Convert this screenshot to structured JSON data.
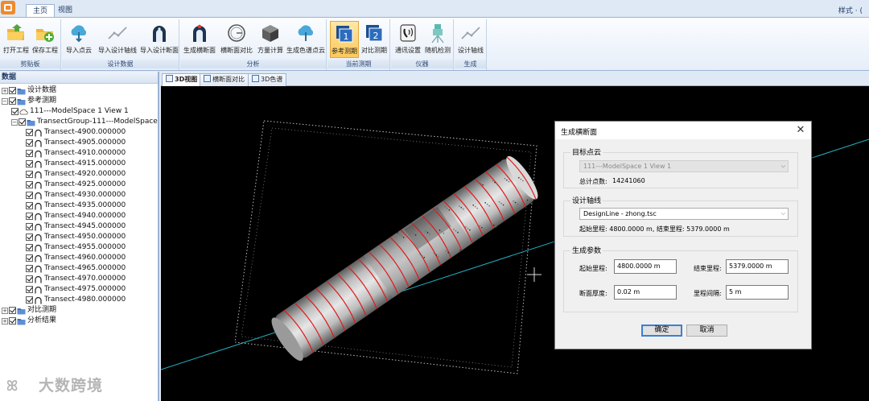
{
  "tabs": [
    {
      "label": "主页",
      "active": true
    },
    {
      "label": "视图",
      "active": false
    }
  ],
  "style_menu": "样式 · (",
  "ribbon": {
    "groups": [
      {
        "label": "剪贴板",
        "buttons": [
          {
            "label": "打开工程",
            "icon": "open-folder-icon"
          },
          {
            "label": "保存工程",
            "icon": "save-folder-icon"
          }
        ]
      },
      {
        "label": "设计数据",
        "buttons": [
          {
            "label": "导入点云",
            "icon": "cloud-import-icon"
          },
          {
            "label": "导入设计轴线",
            "icon": "axis-line-icon"
          },
          {
            "label": "导入设计断面",
            "icon": "tunnel-section-icon"
          }
        ]
      },
      {
        "label": "分析",
        "buttons": [
          {
            "label": "生成横断面",
            "icon": "tunnel-generate-icon"
          },
          {
            "label": "横断面对比",
            "icon": "circle-compare-icon"
          },
          {
            "label": "方量计算",
            "icon": "cube-volume-icon"
          },
          {
            "label": "生成色谱点云",
            "icon": "cloud-color-icon"
          }
        ]
      },
      {
        "label": "当前测期",
        "buttons": [
          {
            "label": "参考测期",
            "icon": "period-one-icon",
            "selected": true
          },
          {
            "label": "对比测期",
            "icon": "period-two-icon"
          }
        ]
      },
      {
        "label": "仪器",
        "buttons": [
          {
            "label": "通讯设置",
            "icon": "phone-settings-icon"
          },
          {
            "label": "随机检测",
            "icon": "instrument-icon"
          }
        ]
      },
      {
        "label": "生成",
        "buttons": [
          {
            "label": "设计轴线",
            "icon": "design-axis-icon"
          }
        ]
      }
    ]
  },
  "left_panel": {
    "header": "数据",
    "tree": [
      {
        "label": "设计数据",
        "level": 0,
        "expander": "+",
        "icon": "folder"
      },
      {
        "label": "参考测期",
        "level": 0,
        "expander": "−",
        "icon": "folder"
      },
      {
        "label": "111---ModelSpace 1 View 1",
        "level": 1,
        "expander": "",
        "icon": "cloud"
      },
      {
        "label": "TransectGroup-111---ModelSpace",
        "level": 1,
        "expander": "−",
        "icon": "folder"
      },
      {
        "label": "Transect-4900.000000",
        "level": 2,
        "expander": "",
        "icon": "section"
      },
      {
        "label": "Transect-4905.000000",
        "level": 2,
        "expander": "",
        "icon": "section"
      },
      {
        "label": "Transect-4910.000000",
        "level": 2,
        "expander": "",
        "icon": "section"
      },
      {
        "label": "Transect-4915.000000",
        "level": 2,
        "expander": "",
        "icon": "section"
      },
      {
        "label": "Transect-4920.000000",
        "level": 2,
        "expander": "",
        "icon": "section"
      },
      {
        "label": "Transect-4925.000000",
        "level": 2,
        "expander": "",
        "icon": "section"
      },
      {
        "label": "Transect-4930.000000",
        "level": 2,
        "expander": "",
        "icon": "section"
      },
      {
        "label": "Transect-4935.000000",
        "level": 2,
        "expander": "",
        "icon": "section"
      },
      {
        "label": "Transect-4940.000000",
        "level": 2,
        "expander": "",
        "icon": "section"
      },
      {
        "label": "Transect-4945.000000",
        "level": 2,
        "expander": "",
        "icon": "section"
      },
      {
        "label": "Transect-4950.000000",
        "level": 2,
        "expander": "",
        "icon": "section"
      },
      {
        "label": "Transect-4955.000000",
        "level": 2,
        "expander": "",
        "icon": "section"
      },
      {
        "label": "Transect-4960.000000",
        "level": 2,
        "expander": "",
        "icon": "section"
      },
      {
        "label": "Transect-4965.000000",
        "level": 2,
        "expander": "",
        "icon": "section"
      },
      {
        "label": "Transect-4970.000000",
        "level": 2,
        "expander": "",
        "icon": "section"
      },
      {
        "label": "Transect-4975.000000",
        "level": 2,
        "expander": "",
        "icon": "section"
      },
      {
        "label": "Transect-4980.000000",
        "level": 2,
        "expander": "",
        "icon": "section"
      },
      {
        "label": "对比测期",
        "level": 0,
        "expander": "+",
        "icon": "folder"
      },
      {
        "label": "分析结果",
        "level": 0,
        "expander": "+",
        "icon": "folder"
      }
    ]
  },
  "view_tabs": [
    {
      "label": "3D视图",
      "active": true
    },
    {
      "label": "横断面对比",
      "active": false
    },
    {
      "label": "3D色谱",
      "active": false
    }
  ],
  "dialog": {
    "title": "生成横断面",
    "target_cloud": {
      "title": "目标点云",
      "selected": "111---ModelSpace 1 View 1",
      "point_count_label": "总计点数:",
      "point_count": "14241060"
    },
    "design_axis": {
      "title": "设计轴线",
      "selected": "DesignLine - zhong.tsc",
      "range_text": "起始里程: 4800.0000 m, 结束里程: 5379.0000 m"
    },
    "params": {
      "title": "生成参数",
      "start_label": "起始里程:",
      "start_value": "4800.0000 m",
      "end_label": "结束里程:",
      "end_value": "5379.0000 m",
      "thickness_label": "断面厚度:",
      "thickness_value": "0.02 m",
      "interval_label": "里程间隔:",
      "interval_value": "5 m"
    },
    "ok_label": "确定",
    "cancel_label": "取消"
  },
  "watermark": {
    "logo": "ꕤ",
    "text": "大数跨境"
  },
  "colors": {
    "ribbon_border": "#9bb3d3",
    "selected_button": "#fcc95b",
    "tunnel_section_line": "#e01818",
    "design_axis_line": "#1fb3c4",
    "viewport_bg": "#000000"
  }
}
